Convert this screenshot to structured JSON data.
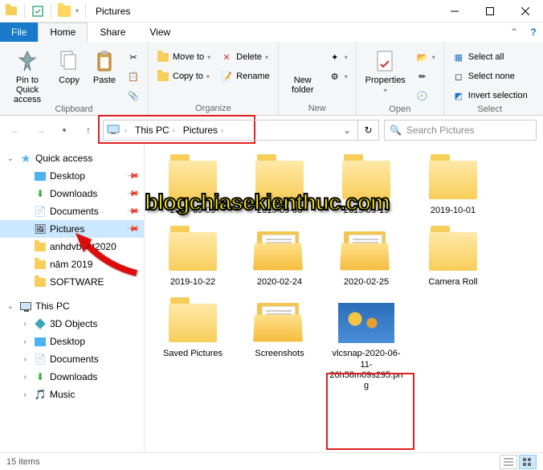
{
  "window": {
    "title": "Pictures"
  },
  "tabs": {
    "file": "File",
    "home": "Home",
    "share": "Share",
    "view": "View"
  },
  "ribbon": {
    "clipboard": {
      "label": "Clipboard",
      "pin": "Pin to Quick access",
      "copy": "Copy",
      "paste": "Paste"
    },
    "organize": {
      "label": "Organize",
      "moveto": "Move to",
      "copyto": "Copy to",
      "delete": "Delete",
      "rename": "Rename"
    },
    "new": {
      "label": "New",
      "folder": "New folder"
    },
    "open": {
      "label": "Open",
      "properties": "Properties"
    },
    "select": {
      "label": "Select",
      "all": "Select all",
      "none": "Select none",
      "invert": "Invert selection"
    }
  },
  "breadcrumb": {
    "root": "This PC",
    "current": "Pictures"
  },
  "search": {
    "placeholder": "Search Pictures"
  },
  "sidebar": {
    "quick": "Quick access",
    "desktop": "Desktop",
    "downloads": "Downloads",
    "documents": "Documents",
    "pictures": "Pictures",
    "anhdv": "anhdvboot2020",
    "nam": "năm 2019",
    "software": "SOFTWARE",
    "thispc": "This PC",
    "objects3d": "3D Objects",
    "desktop2": "Desktop",
    "documents2": "Documents",
    "downloads2": "Downloads",
    "music": "Music"
  },
  "items": [
    {
      "name": "2019-09-05",
      "kind": "folder"
    },
    {
      "name": "2019-09-06",
      "kind": "folder"
    },
    {
      "name": "2019-09-19",
      "kind": "folder"
    },
    {
      "name": "2019-10-01",
      "kind": "folder"
    },
    {
      "name": "2019-10-22",
      "kind": "folder"
    },
    {
      "name": "2020-02-24",
      "kind": "folder-docs"
    },
    {
      "name": "2020-02-25",
      "kind": "folder-docs"
    },
    {
      "name": "Camera Roll",
      "kind": "folder"
    },
    {
      "name": "Saved Pictures",
      "kind": "folder"
    },
    {
      "name": "Screenshots",
      "kind": "folder-docs"
    },
    {
      "name": "vlcsnap-2020-06-11-20h58m09s295.png",
      "kind": "image"
    }
  ],
  "status": {
    "count": "15 items"
  },
  "watermark": "blogchiasekienthuc.com"
}
